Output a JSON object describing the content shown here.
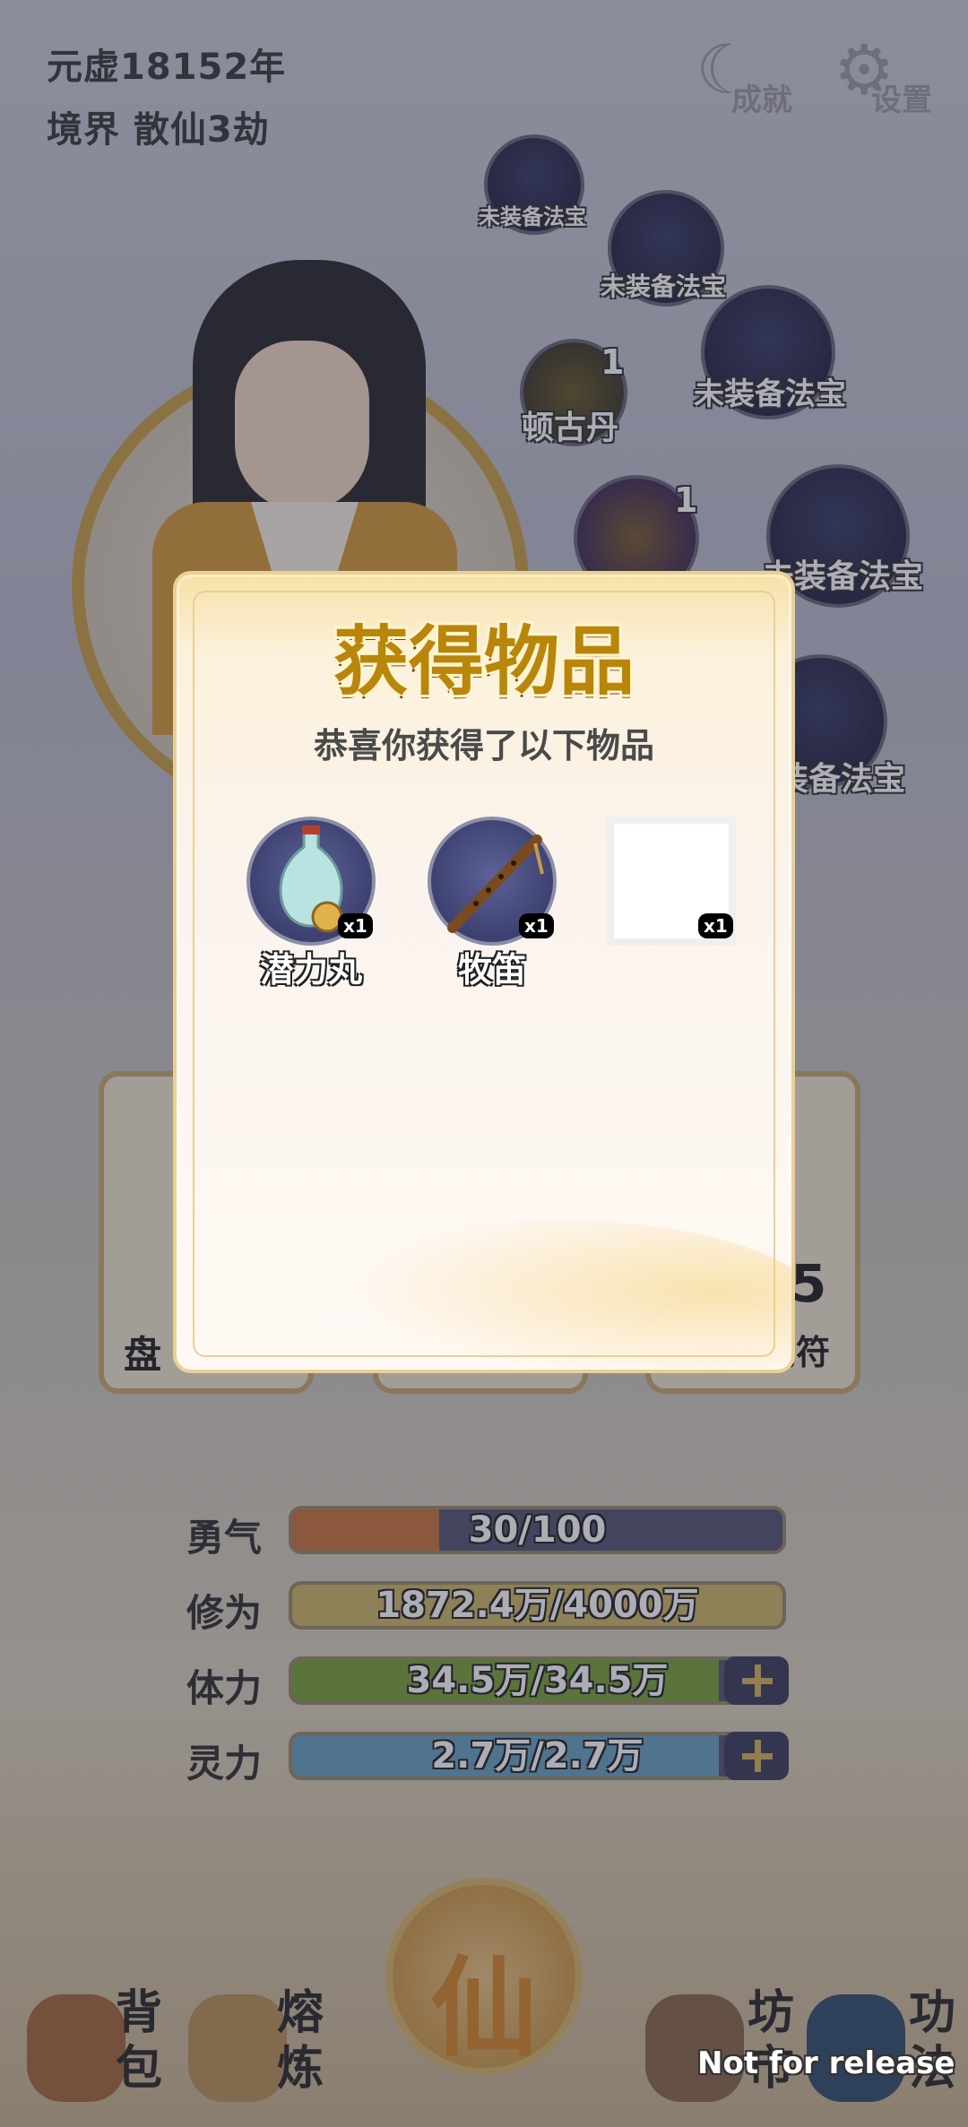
{
  "hud": {
    "era": "元虚18152年",
    "realm_label": "境界",
    "realm_value": "散仙3劫",
    "achievement_label": "成就",
    "settings_label": "设置"
  },
  "slots": {
    "empty_label": "未装备法宝",
    "filled": [
      {
        "name": "顿古丹",
        "count": "1"
      },
      {
        "name": "",
        "count": "1"
      }
    ]
  },
  "bg_cards": {
    "left_label": "盘",
    "right_count": "5",
    "right_label": "剑符"
  },
  "stats": [
    {
      "label": "勇气",
      "value": "30/100",
      "fill": 0.3,
      "color": "#c9773f",
      "plus": false
    },
    {
      "label": "修为",
      "value": "1872.4万/4000万",
      "fill": 1.0,
      "color": "#cdb768",
      "plus": false
    },
    {
      "label": "体力",
      "value": "34.5万/34.5万",
      "fill": 1.0,
      "color": "#7aa43a",
      "plus": true
    },
    {
      "label": "灵力",
      "value": "2.7万/2.7万",
      "fill": 1.0,
      "color": "#6ba3c0",
      "plus": true
    }
  ],
  "nav": {
    "bag": "背包",
    "smelt": "熔炼",
    "center": "仙",
    "market": "坊市",
    "skills": "功法"
  },
  "watermark": "Not for release",
  "modal": {
    "title": "获得物品",
    "subtitle": "恭喜你获得了以下物品",
    "items": [
      {
        "name": "潜力丸",
        "qty": "x1",
        "icon": "vase-icon"
      },
      {
        "name": "牧笛",
        "qty": "x1",
        "icon": "flute-icon"
      },
      {
        "name": "",
        "qty": "x1",
        "icon": "blank-item-icon"
      }
    ]
  }
}
